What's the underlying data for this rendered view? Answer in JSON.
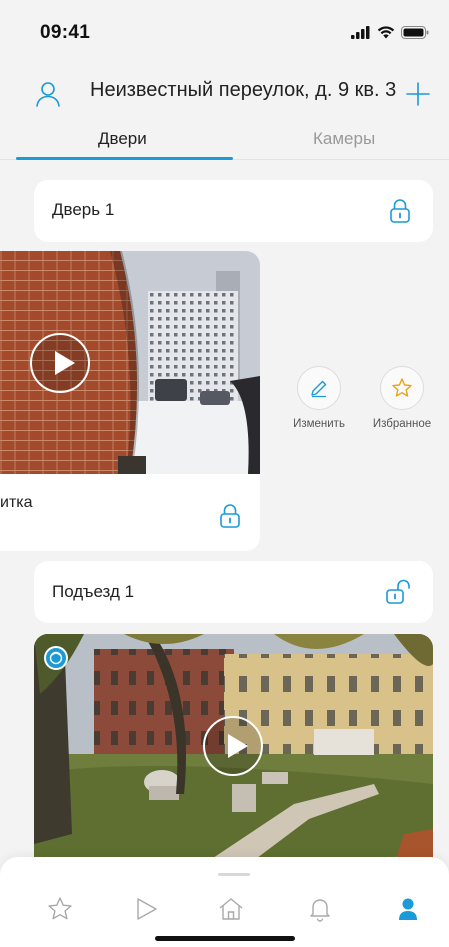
{
  "status_bar": {
    "time": "09:41"
  },
  "header": {
    "address": "Неизвестный переулок, д. 9 кв. 3"
  },
  "tabs": [
    {
      "label": "Двери",
      "active": true
    },
    {
      "label": "Камеры",
      "active": false
    }
  ],
  "doors": [
    {
      "title": "Дверь 1",
      "icon": "lock-closed-icon"
    },
    {
      "title": "Подъезд 1",
      "icon": "lock-open-icon"
    }
  ],
  "video": {
    "caption": "итка"
  },
  "actions": [
    {
      "label": "Изменить",
      "icon": "pencil-icon"
    },
    {
      "label": "Избранное",
      "icon": "star-icon"
    }
  ],
  "bottom_nav": [
    {
      "icon": "star-icon",
      "active": false
    },
    {
      "icon": "play-icon",
      "active": false
    },
    {
      "icon": "home-icon",
      "active": false
    },
    {
      "icon": "bell-icon",
      "active": false
    },
    {
      "icon": "profile-icon",
      "active": true
    }
  ],
  "colors": {
    "accent": "#1a9ad6",
    "background": "#f3f3f3",
    "card": "#ffffff",
    "text": "#222222",
    "muted": "#999999"
  }
}
